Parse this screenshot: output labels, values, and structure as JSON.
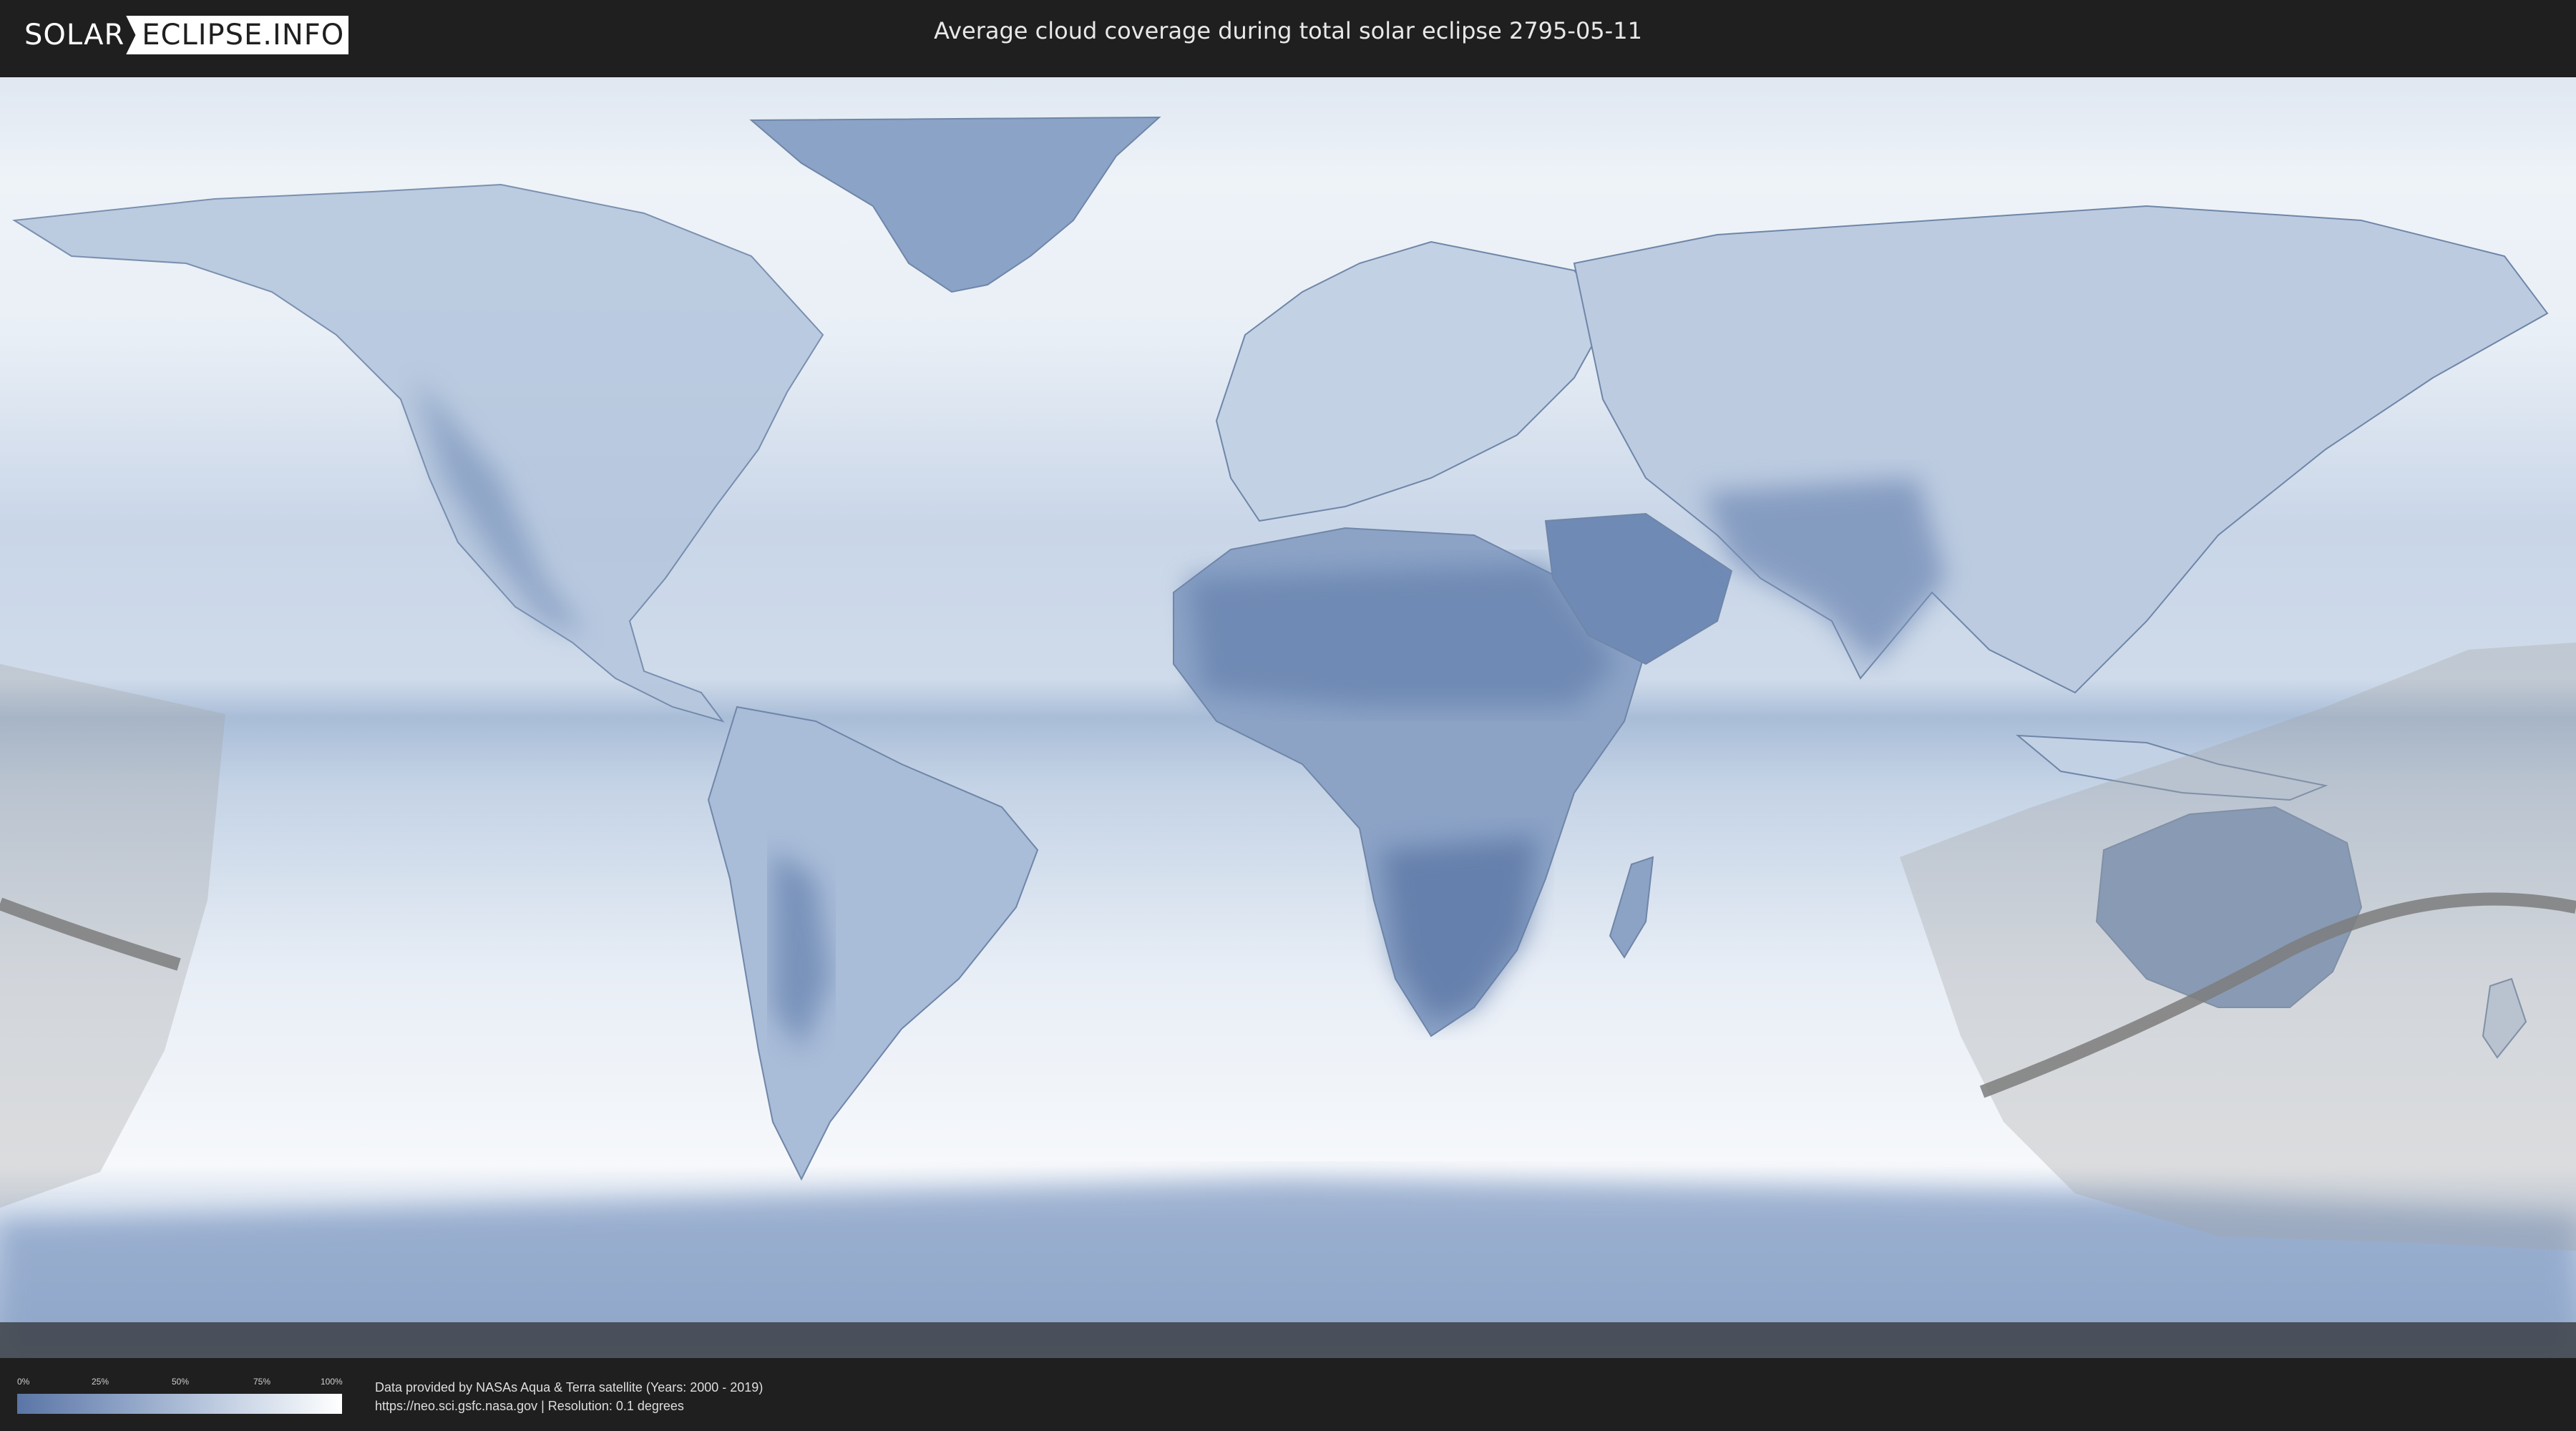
{
  "header": {
    "logo_left": "SOLAR",
    "logo_right": "ECLIPSE.INFO",
    "title": "Average cloud coverage during total solar eclipse 2795-05-11"
  },
  "legend": {
    "ticks": [
      "0%",
      "25%",
      "50%",
      "75%",
      "100%"
    ],
    "colors": {
      "low": "#5a75a6",
      "high": "#ffffff"
    }
  },
  "credits": {
    "line1": "Data provided by NASAs Aqua & Terra satellite (Years: 2000 - 2019)",
    "line2": "https://neo.sci.gsfc.nasa.gov | Resolution: 0.1 degrees"
  }
}
